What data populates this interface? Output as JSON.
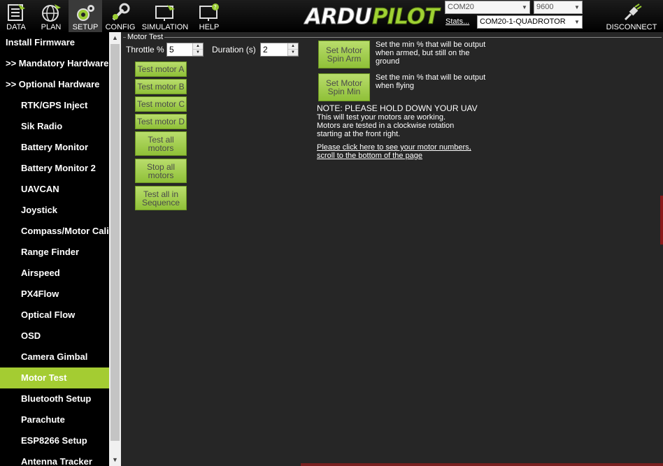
{
  "toolbar": {
    "buttons": [
      {
        "label": "DATA",
        "icon": "data-screen-icon"
      },
      {
        "label": "PLAN",
        "icon": "globe-icon"
      },
      {
        "label": "SETUP",
        "icon": "gear-icon"
      },
      {
        "label": "CONFIG",
        "icon": "wrench-icon"
      },
      {
        "label": "SIMULATION",
        "icon": "monitor-plane-icon"
      },
      {
        "label": "HELP",
        "icon": "help-monitor-icon"
      }
    ],
    "logo_text": "ARDUPILOT",
    "port": "COM20",
    "baud": "9600",
    "stats_label": "Stats...",
    "vehicle": "COM20-1-QUADROTOR",
    "disconnect_label": "DISCONNECT"
  },
  "sidebar": {
    "items": [
      {
        "label": "Install Firmware",
        "level": "top"
      },
      {
        "label": ">> Mandatory Hardware",
        "level": "top"
      },
      {
        "label": ">> Optional Hardware",
        "level": "top"
      },
      {
        "label": "RTK/GPS Inject",
        "level": "sub"
      },
      {
        "label": "Sik Radio",
        "level": "sub"
      },
      {
        "label": "Battery Monitor",
        "level": "sub"
      },
      {
        "label": "Battery Monitor 2",
        "level": "sub"
      },
      {
        "label": "UAVCAN",
        "level": "sub"
      },
      {
        "label": "Joystick",
        "level": "sub"
      },
      {
        "label": "Compass/Motor Calib",
        "level": "sub"
      },
      {
        "label": "Range Finder",
        "level": "sub"
      },
      {
        "label": "Airspeed",
        "level": "sub"
      },
      {
        "label": "PX4Flow",
        "level": "sub"
      },
      {
        "label": "Optical Flow",
        "level": "sub"
      },
      {
        "label": "OSD",
        "level": "sub"
      },
      {
        "label": "Camera Gimbal",
        "level": "sub"
      },
      {
        "label": "Motor Test",
        "level": "sub",
        "active": true
      },
      {
        "label": "Bluetooth Setup",
        "level": "sub"
      },
      {
        "label": "Parachute",
        "level": "sub"
      },
      {
        "label": "ESP8266 Setup",
        "level": "sub"
      },
      {
        "label": "Antenna Tracker",
        "level": "sub"
      }
    ]
  },
  "motor_test": {
    "group_title": "Motor Test",
    "throttle_label": "Throttle %",
    "throttle_value": "5",
    "duration_label": "Duration (s)",
    "duration_value": "2",
    "buttons": {
      "motor_a": "Test motor A",
      "motor_b": "Test motor B",
      "motor_c": "Test motor C",
      "motor_d": "Test motor D",
      "test_all": "Test all motors",
      "stop_all": "Stop all motors",
      "sequence": "Test all in Sequence",
      "spin_arm": "Set Motor Spin Arm",
      "spin_min": "Set Motor Spin Min"
    },
    "spin_arm_desc": "Set the min % that will be output when armed, but still on the ground",
    "spin_min_desc": "Set the min % that will be output when flying",
    "note_line1": "NOTE: PLEASE HOLD DOWN YOUR UAV",
    "note_line2": "This will test your motors are working.",
    "note_line3": "Motors are tested in a clockwise rotation",
    "note_line4": "starting at the front right.",
    "link_line1": "Please click here to see your motor numbers,",
    "link_line2": "scroll to the bottom of the page"
  },
  "colors": {
    "accent": "#a4cc32",
    "button_green": "#a8d055",
    "background": "#262626"
  }
}
